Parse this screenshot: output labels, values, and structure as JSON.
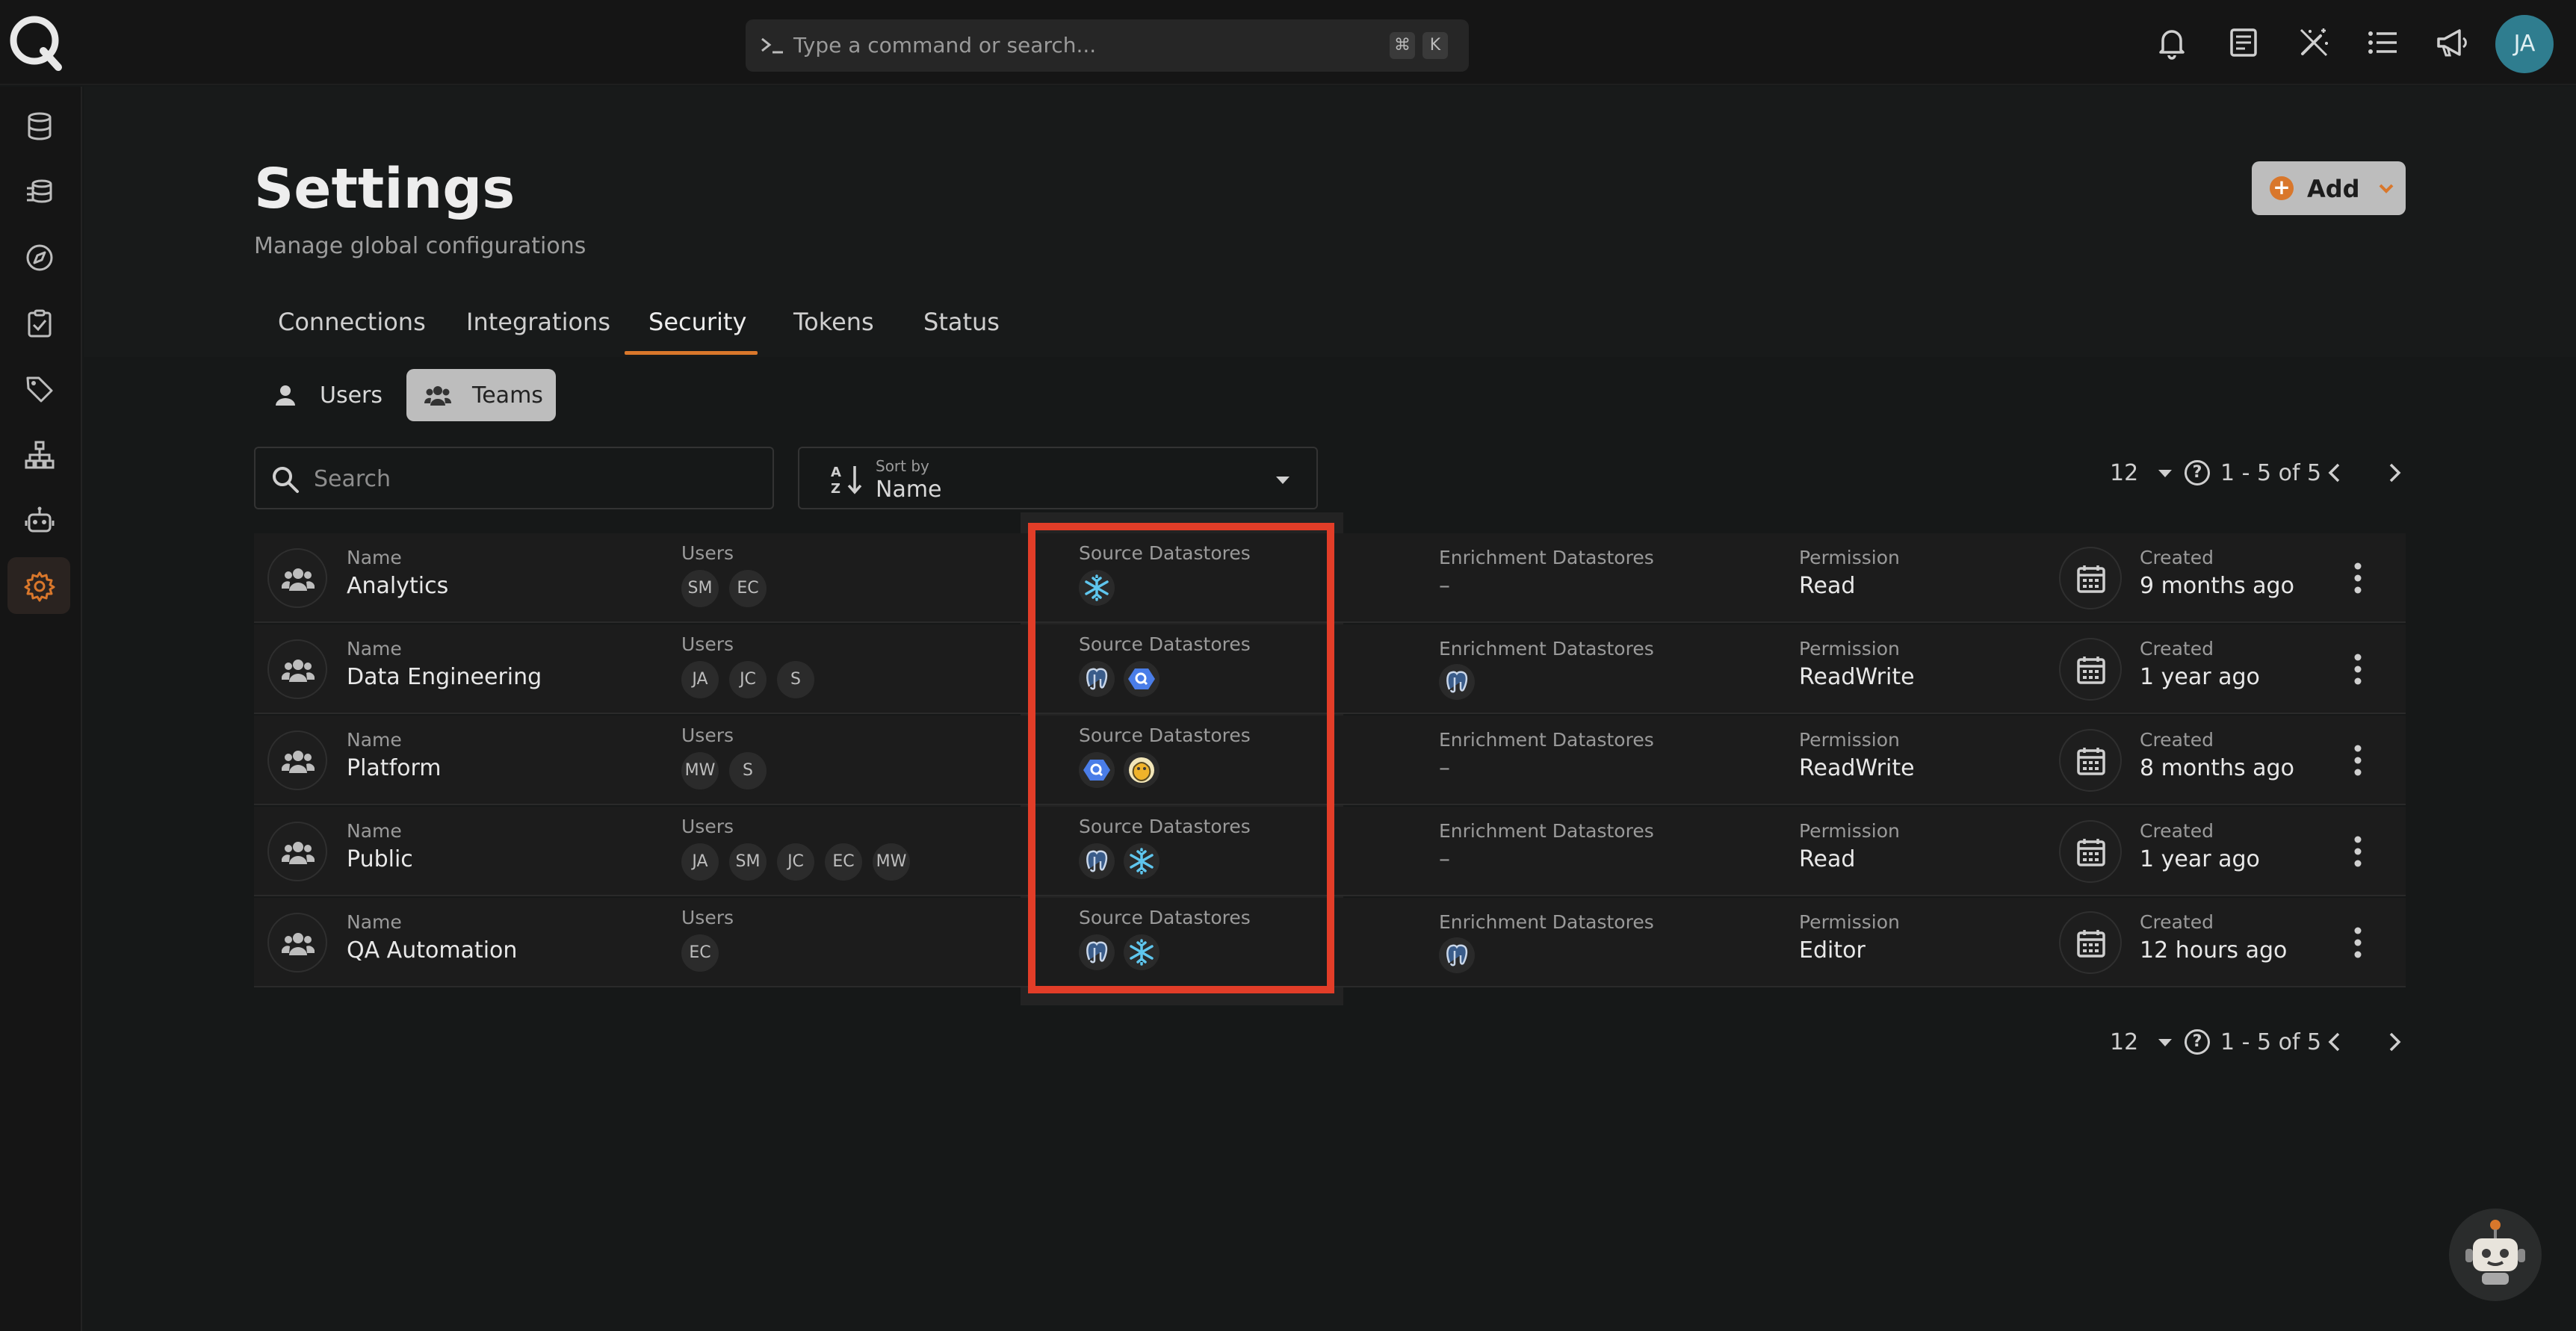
{
  "search_bar": {
    "placeholder": "Type a command or search...",
    "shortcut_keys": [
      "⌘",
      "K"
    ]
  },
  "user": {
    "initials": "JA"
  },
  "top_icons": [
    "bell-icon",
    "notes-icon",
    "magic-wand-icon",
    "list-icon",
    "megaphone-icon"
  ],
  "sidebar": {
    "items": [
      "database-icon",
      "stacked-databases-icon",
      "compass-icon",
      "checklist-icon",
      "tag-icon",
      "hierarchy-icon",
      "robot-icon",
      "gear-icon"
    ],
    "active": "gear-icon"
  },
  "header": {
    "title": "Settings",
    "subtitle": "Manage global configurations",
    "add_label": "Add"
  },
  "tabs": [
    {
      "label": "Connections"
    },
    {
      "label": "Integrations"
    },
    {
      "label": "Security",
      "active": true
    },
    {
      "label": "Tokens"
    },
    {
      "label": "Status"
    }
  ],
  "view_toggle": {
    "users_label": "Users",
    "teams_label": "Teams",
    "active": "Teams"
  },
  "filters": {
    "search_placeholder": "Search",
    "sort_caption": "Sort by",
    "sort_value": "Name"
  },
  "pagination": {
    "page_size": "12",
    "range": "1 - 5 of 5"
  },
  "columns": {
    "name": "Name",
    "users": "Users",
    "source": "Source Datastores",
    "enrichment": "Enrichment Datastores",
    "permission": "Permission",
    "created": "Created"
  },
  "teams": [
    {
      "name": "Analytics",
      "users": [
        "SM",
        "EC"
      ],
      "source": [
        "snowflake"
      ],
      "enrichment": "–",
      "permission": "Read",
      "created": "9 months ago"
    },
    {
      "name": "Data Engineering",
      "users": [
        "JA",
        "JC",
        "S"
      ],
      "source": [
        "postgres",
        "bigquery"
      ],
      "enrichment_icons": [
        "postgres"
      ],
      "permission": "ReadWrite",
      "created": "1 year ago"
    },
    {
      "name": "Platform",
      "users": [
        "MW",
        "S"
      ],
      "source": [
        "bigquery",
        "hive"
      ],
      "enrichment": "–",
      "permission": "ReadWrite",
      "created": "8 months ago"
    },
    {
      "name": "Public",
      "users": [
        "JA",
        "SM",
        "JC",
        "EC",
        "MW"
      ],
      "source": [
        "postgres",
        "snowflake"
      ],
      "enrichment": "–",
      "permission": "Read",
      "created": "1 year ago"
    },
    {
      "name": "QA Automation",
      "users": [
        "EC"
      ],
      "source": [
        "postgres",
        "snowflake"
      ],
      "enrichment_icons": [
        "postgres"
      ],
      "permission": "Editor",
      "created": "12 hours ago"
    }
  ],
  "colors": {
    "accent": "#d9772b",
    "highlight": "#e23d28",
    "avatar": "#2f7d8f"
  }
}
